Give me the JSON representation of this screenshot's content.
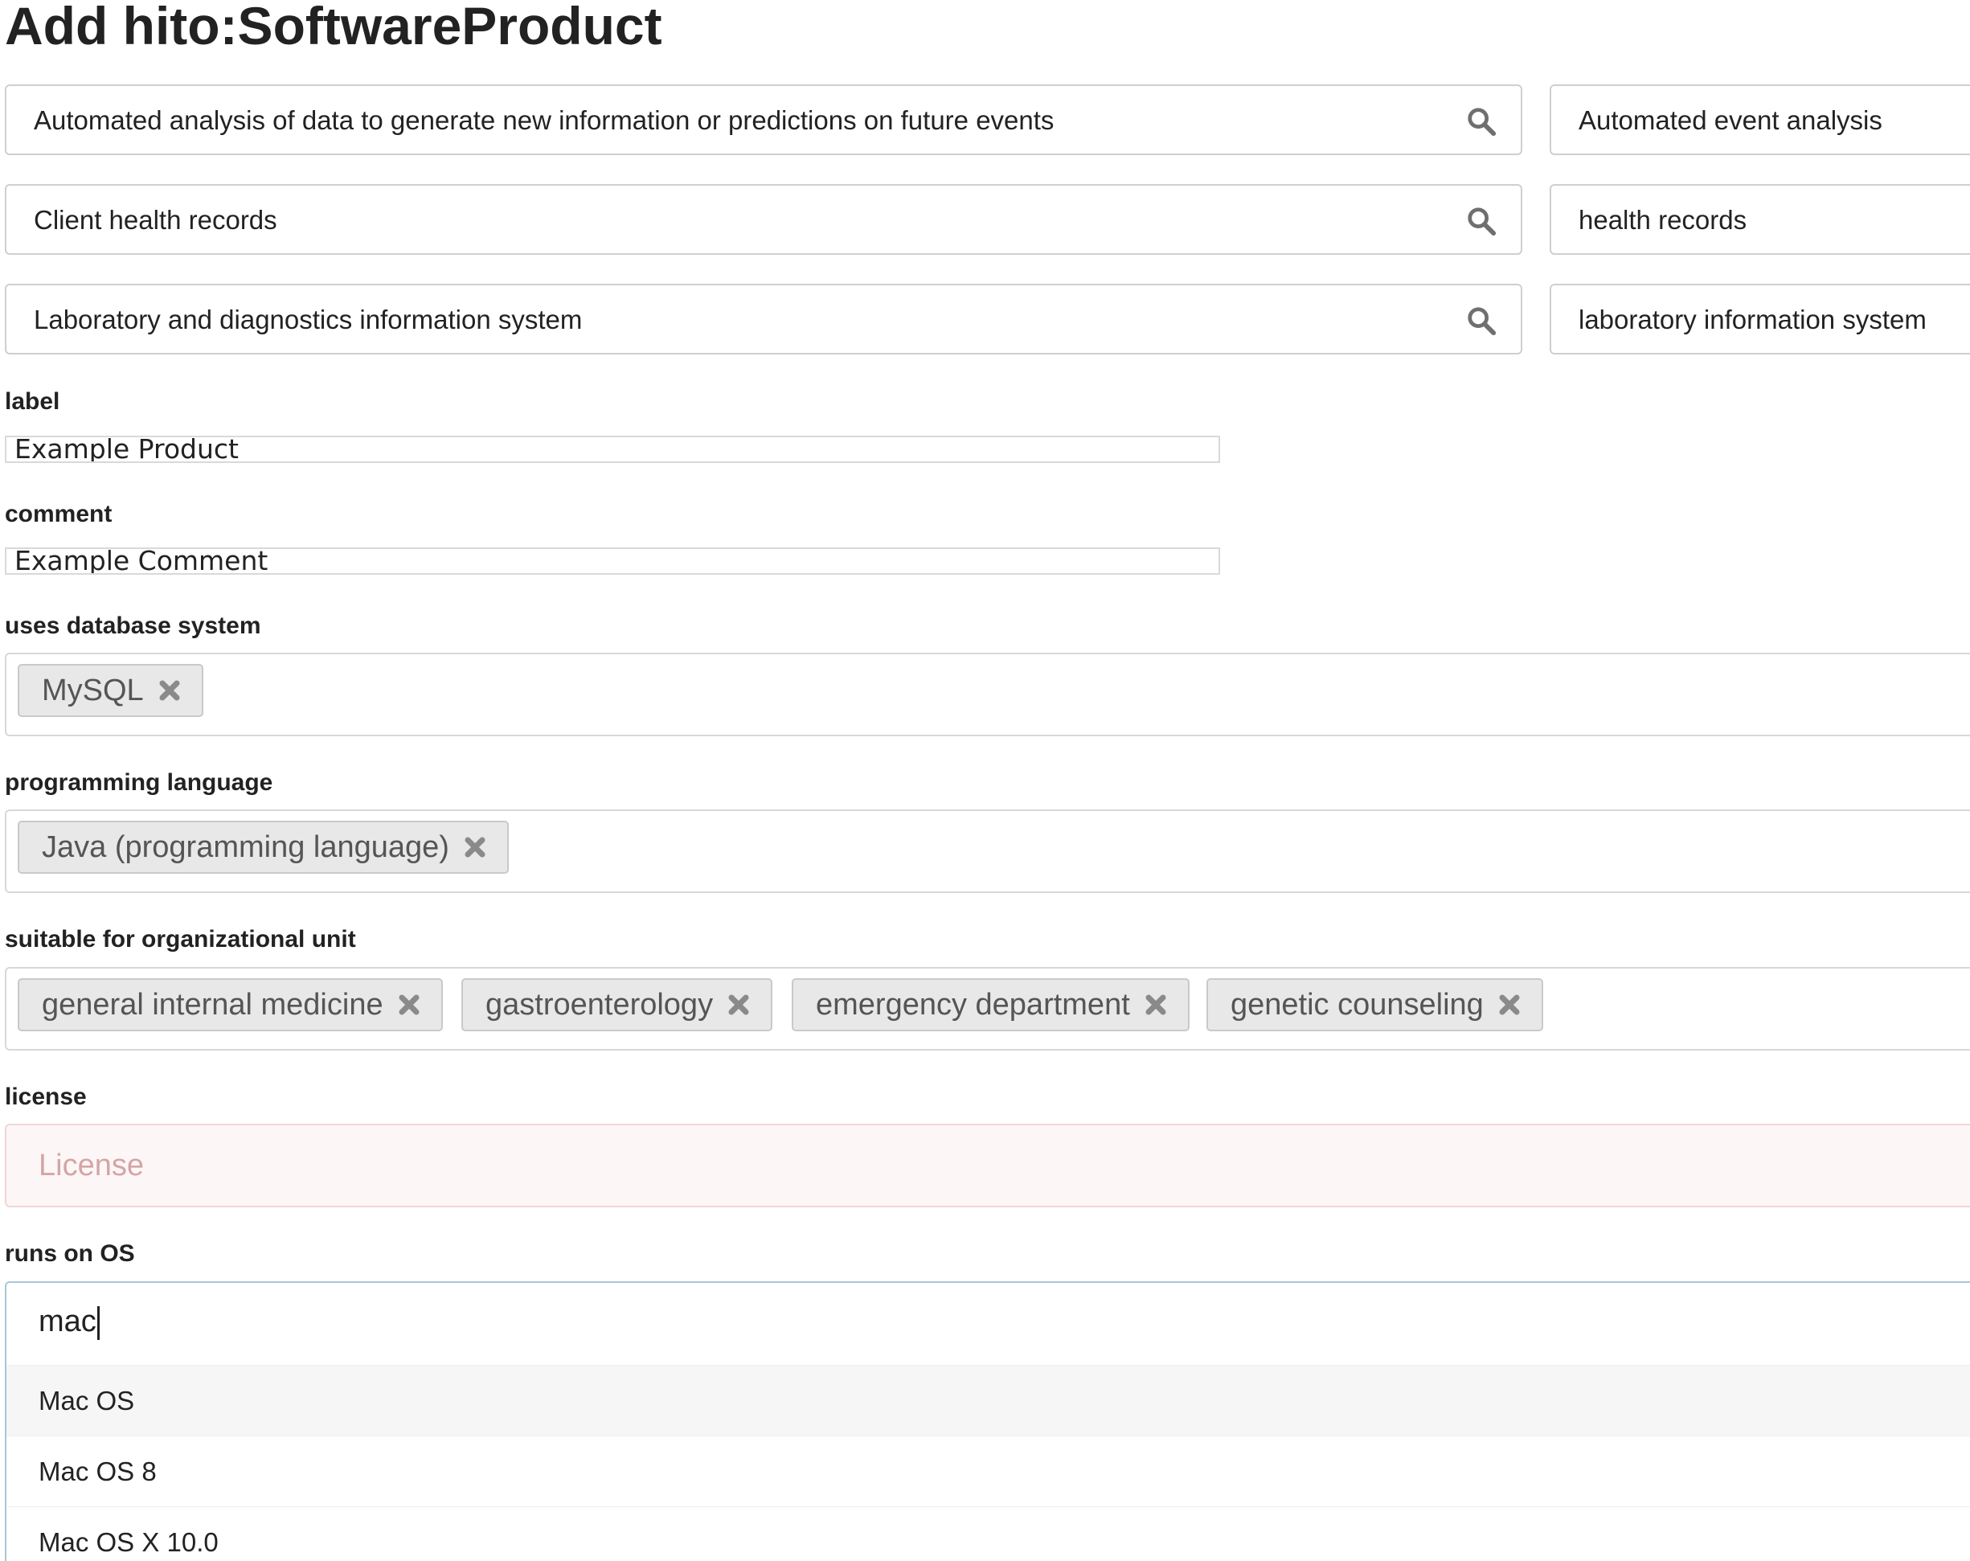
{
  "page": {
    "title": "Add hito:SoftwareProduct"
  },
  "search_rows": [
    {
      "query": "Automated analysis of data to generate new information or predictions on future events",
      "result": "Automated event analysis"
    },
    {
      "query": "Client health records",
      "result": "health records"
    },
    {
      "query": "Laboratory and diagnostics information system",
      "result": "laboratory information system"
    }
  ],
  "fields": {
    "label": {
      "label": "label",
      "value": "Example Product"
    },
    "comment": {
      "label": "comment",
      "value": "Example Comment"
    },
    "database": {
      "label": "uses database system",
      "tags": [
        "MySQL"
      ]
    },
    "language": {
      "label": "programming language",
      "tags": [
        "Java (programming language)"
      ]
    },
    "org_unit": {
      "label": "suitable for organizational unit",
      "tags": [
        "general internal medicine",
        "gastroenterology",
        "emergency department",
        "genetic counseling"
      ]
    },
    "license": {
      "label": "license",
      "placeholder": "License"
    },
    "os": {
      "label": "runs on OS",
      "input_value": "mac",
      "options": [
        "Mac OS",
        "Mac OS 8",
        "Mac OS X 10.0"
      ],
      "highlighted_option": "Mac OS"
    }
  },
  "icons": {
    "search": "search-icon",
    "remove": "close-icon"
  },
  "colors": {
    "tag_background": "#e8e8e8",
    "license_background": "#fdf6f6",
    "license_placeholder": "#d4a5a5",
    "focus_border": "#a9c6d6",
    "option_highlight": "#f6f6f6"
  }
}
